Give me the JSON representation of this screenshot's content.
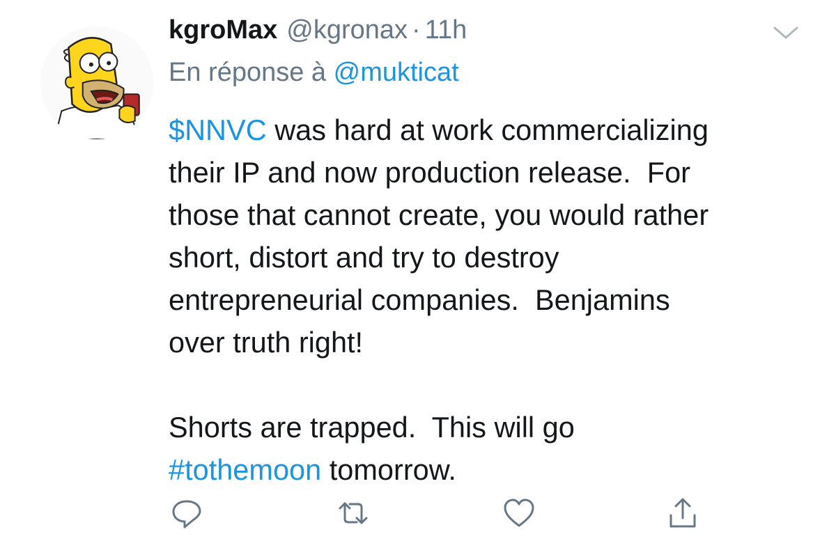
{
  "tweet": {
    "display_name": "kgroMax",
    "handle": "@kgronax",
    "separator": "·",
    "time": "11h",
    "reply_prefix": "En réponse à",
    "reply_mention": "@mukticat",
    "body": {
      "cashtag": "$NNVC",
      "text_1": " was hard at work commercializing\ntheir IP and now production release.  For\nthose that cannot create, you would rather\nshort, distort and try to destroy\nentrepreneurial companies.  Benjamins\nover truth right!\n\nShorts are trapped.  This will go\n",
      "hashtag": "#tothemoon",
      "text_2": " tomorrow."
    }
  },
  "icons": {
    "menu": "chevron-down-icon",
    "reply": "reply-icon",
    "retweet": "retweet-icon",
    "like": "heart-icon",
    "share": "share-icon",
    "avatar": "avatar"
  },
  "colors": {
    "link": "#1b95e0",
    "secondary_text": "#657786",
    "icon": "#657786",
    "text": "#14171a"
  }
}
